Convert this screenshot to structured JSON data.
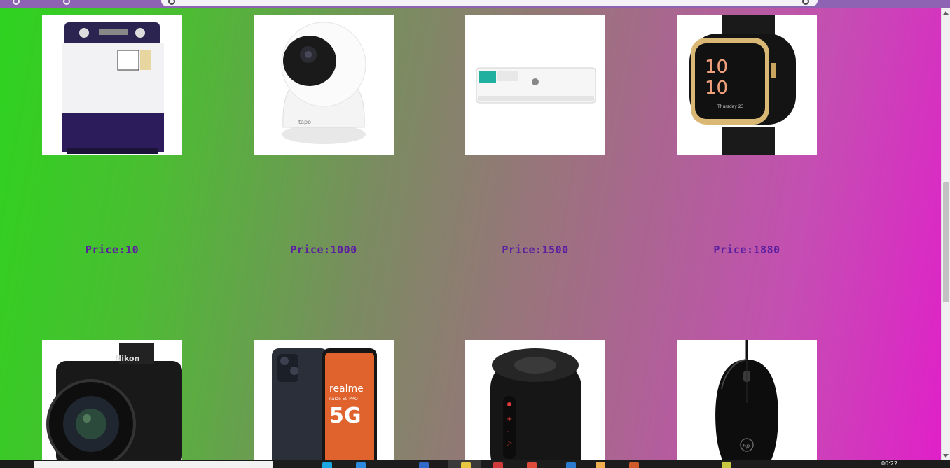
{
  "products_row1": [
    {
      "name": "washing-machine",
      "price": "Price:10"
    },
    {
      "name": "security-camera",
      "price": "Price:1000"
    },
    {
      "name": "air-conditioner",
      "price": "Price:1500"
    },
    {
      "name": "smartwatch",
      "price": "Price:1880"
    }
  ],
  "products_row2": [
    {
      "name": "camera-nikon",
      "brand": "Nikon"
    },
    {
      "name": "phone-realme",
      "brand": "realme",
      "sub": "narzo 50 PRO",
      "badge": "5G"
    },
    {
      "name": "speaker",
      "brand": ""
    },
    {
      "name": "mouse-hp",
      "brand": "hp"
    }
  ],
  "camera_brand_label": "tapo",
  "watch_time": [
    "10",
    "10"
  ],
  "watch_date": "Thursday 23",
  "taskbar": {
    "clock": "00:22"
  },
  "colors": {
    "price": "#5b1fa0",
    "gradient_left": "#2ed31f",
    "gradient_right": "#e020c8",
    "chrome": "#8e63b3"
  }
}
